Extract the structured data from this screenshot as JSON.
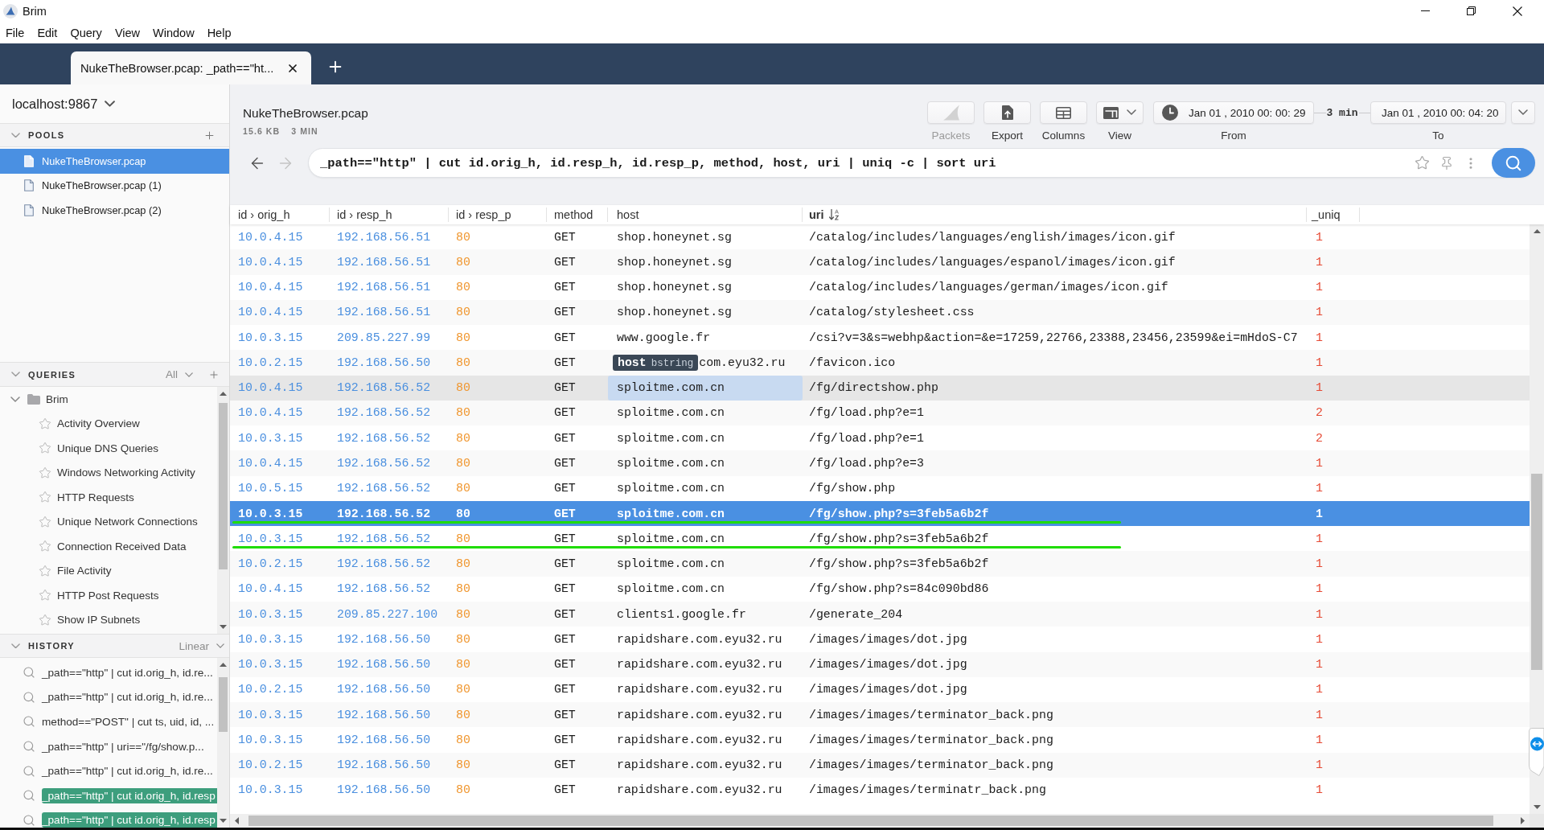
{
  "window": {
    "title": "Brim"
  },
  "menu": [
    "File",
    "Edit",
    "Query",
    "View",
    "Window",
    "Help"
  ],
  "tabs": [
    {
      "label": "NukeTheBrowser.pcap: _path==\"ht...",
      "selected": true
    }
  ],
  "sidebar": {
    "workspace": "localhost:9867",
    "pools": {
      "title": "POOLS",
      "expanded": true,
      "items": [
        {
          "name": "NukeTheBrowser.pcap",
          "selected": true
        },
        {
          "name": "NukeTheBrowser.pcap (1)",
          "selected": false
        },
        {
          "name": "NukeTheBrowser.pcap (2)",
          "selected": false
        }
      ]
    },
    "queries": {
      "title": "QUERIES",
      "filter": "All",
      "expanded": true,
      "folders": [
        {
          "name": "Brim",
          "expanded": true,
          "children": [
            {
              "name": "Activity Overview",
              "starred": false
            },
            {
              "name": "Unique DNS Queries",
              "starred": false
            },
            {
              "name": "Windows Networking Activity",
              "starred": false
            },
            {
              "name": "HTTP Requests",
              "starred": false
            },
            {
              "name": "Unique Network Connections",
              "starred": false
            },
            {
              "name": "Connection Received Data",
              "starred": false
            },
            {
              "name": "File Activity",
              "starred": false
            },
            {
              "name": "HTTP Post Requests",
              "starred": false
            },
            {
              "name": "Show IP Subnets",
              "starred": false
            }
          ]
        }
      ]
    },
    "history": {
      "title": "HISTORY",
      "mode": "Linear",
      "expanded": true,
      "items": [
        {
          "query": "_path==\"http\" | cut id.orig_h, id.re...",
          "highlighted": false
        },
        {
          "query": "_path==\"http\" | cut id.orig_h, id.re...",
          "highlighted": false
        },
        {
          "query": "method==\"POST\" | cut ts, uid, id, ...",
          "highlighted": false
        },
        {
          "query": "_path==\"http\" | uri==\"/fg/show.p...",
          "highlighted": false
        },
        {
          "query": "_path==\"http\" | cut id.orig_h, id.re...",
          "highlighted": false
        },
        {
          "query": "_path==\"http\" | cut id.orig_h, id.resp",
          "highlighted": true
        },
        {
          "query": "_path==\"http\" | cut id.orig_h, id.resp",
          "highlighted": true
        }
      ]
    }
  },
  "pool_header": {
    "name": "NukeTheBrowser.pcap",
    "size": "15.6 KB",
    "duration": "3 MIN"
  },
  "toolbar": {
    "buttons": [
      {
        "kind": "packets",
        "label": "Packets",
        "disabled": true
      },
      {
        "kind": "export",
        "label": "Export",
        "disabled": false
      },
      {
        "kind": "columns",
        "label": "Columns",
        "disabled": false
      },
      {
        "kind": "view",
        "label": "View",
        "disabled": false
      }
    ],
    "time_range": {
      "from": "Jan 01 , 2010 00: 00: 29",
      "from_label": "From",
      "span": "3 min",
      "to": "Jan 01 , 2010 00: 04: 20",
      "to_label": "To"
    }
  },
  "search": {
    "query": "_path==\"http\" | cut id.orig_h, id.resp_h, id.resp_p, method, host, uri | uniq -c | sort uri",
    "back_disabled": false,
    "forward_disabled": true
  },
  "table": {
    "columns": [
      {
        "label": "id › orig_h",
        "kind": "address",
        "sorted": false
      },
      {
        "label": "id › resp_h",
        "kind": "address",
        "sorted": false
      },
      {
        "label": "id › resp_p",
        "kind": "port",
        "sorted": false
      },
      {
        "label": "method",
        "kind": "text",
        "sorted": false
      },
      {
        "label": "host",
        "kind": "host",
        "sorted": false
      },
      {
        "label": "uri",
        "kind": "text",
        "sorted": true
      },
      {
        "label": "_uniq",
        "kind": "count",
        "sorted": false
      }
    ],
    "rows": [
      {
        "cells": [
          "10.0.4.15",
          "192.168.56.51",
          "80",
          "GET",
          "shop.honeynet.sg",
          "/catalog/includes/languages/english/images/icon.gif",
          "1"
        ],
        "selected": false,
        "hovered": false,
        "host_focused": false,
        "underlined": false
      },
      {
        "cells": [
          "10.0.4.15",
          "192.168.56.51",
          "80",
          "GET",
          "shop.honeynet.sg",
          "/catalog/includes/languages/espanol/images/icon.gif",
          "1"
        ],
        "selected": false,
        "hovered": false,
        "host_focused": false,
        "underlined": false
      },
      {
        "cells": [
          "10.0.4.15",
          "192.168.56.51",
          "80",
          "GET",
          "shop.honeynet.sg",
          "/catalog/includes/languages/german/images/icon.gif",
          "1"
        ],
        "selected": false,
        "hovered": false,
        "host_focused": false,
        "underlined": false
      },
      {
        "cells": [
          "10.0.4.15",
          "192.168.56.51",
          "80",
          "GET",
          "shop.honeynet.sg",
          "/catalog/stylesheet.css",
          "1"
        ],
        "selected": false,
        "hovered": false,
        "host_focused": false,
        "underlined": false
      },
      {
        "cells": [
          "10.0.3.15",
          "209.85.227.99",
          "80",
          "GET",
          "www.google.fr",
          "/csi?v=3&s=webhp&action=&e=17259,22766,23388,23456,23599&ei=mHdoS-C7",
          "1"
        ],
        "selected": false,
        "hovered": false,
        "host_focused": false,
        "underlined": false
      },
      {
        "cells": [
          "10.0.2.15",
          "192.168.56.50",
          "80",
          "GET",
          "com.eyu32.ru",
          "/favicon.ico",
          "1"
        ],
        "selected": false,
        "hovered": false,
        "host_focused": false,
        "underlined": false,
        "tooltip": {
          "name": "host",
          "type": "bstring"
        }
      },
      {
        "cells": [
          "10.0.4.15",
          "192.168.56.52",
          "80",
          "GET",
          "sploitme.com.cn",
          "/fg/directshow.php",
          "1"
        ],
        "selected": false,
        "hovered": true,
        "host_focused": true,
        "underlined": false
      },
      {
        "cells": [
          "10.0.4.15",
          "192.168.56.52",
          "80",
          "GET",
          "sploitme.com.cn",
          "/fg/load.php?e=1",
          "2"
        ],
        "selected": false,
        "hovered": false,
        "host_focused": false,
        "underlined": false
      },
      {
        "cells": [
          "10.0.3.15",
          "192.168.56.52",
          "80",
          "GET",
          "sploitme.com.cn",
          "/fg/load.php?e=1",
          "2"
        ],
        "selected": false,
        "hovered": false,
        "host_focused": false,
        "underlined": false
      },
      {
        "cells": [
          "10.0.4.15",
          "192.168.56.52",
          "80",
          "GET",
          "sploitme.com.cn",
          "/fg/load.php?e=3",
          "1"
        ],
        "selected": false,
        "hovered": false,
        "host_focused": false,
        "underlined": false
      },
      {
        "cells": [
          "10.0.5.15",
          "192.168.56.52",
          "80",
          "GET",
          "sploitme.com.cn",
          "/fg/show.php",
          "1"
        ],
        "selected": false,
        "hovered": false,
        "host_focused": false,
        "underlined": false
      },
      {
        "cells": [
          "10.0.3.15",
          "192.168.56.52",
          "80",
          "GET",
          "sploitme.com.cn",
          "/fg/show.php?s=3feb5a6b2f",
          "1"
        ],
        "selected": true,
        "hovered": false,
        "host_focused": false,
        "underlined": true
      },
      {
        "cells": [
          "10.0.3.15",
          "192.168.56.52",
          "80",
          "GET",
          "sploitme.com.cn",
          "/fg/show.php?s=3feb5a6b2f",
          "1"
        ],
        "selected": false,
        "hovered": false,
        "host_focused": false,
        "underlined": true
      },
      {
        "cells": [
          "10.0.2.15",
          "192.168.56.52",
          "80",
          "GET",
          "sploitme.com.cn",
          "/fg/show.php?s=3feb5a6b2f",
          "1"
        ],
        "selected": false,
        "hovered": false,
        "host_focused": false,
        "underlined": false
      },
      {
        "cells": [
          "10.0.4.15",
          "192.168.56.52",
          "80",
          "GET",
          "sploitme.com.cn",
          "/fg/show.php?s=84c090bd86",
          "1"
        ],
        "selected": false,
        "hovered": false,
        "host_focused": false,
        "underlined": false
      },
      {
        "cells": [
          "10.0.3.15",
          "209.85.227.100",
          "80",
          "GET",
          "clients1.google.fr",
          "/generate_204",
          "1"
        ],
        "selected": false,
        "hovered": false,
        "host_focused": false,
        "underlined": false
      },
      {
        "cells": [
          "10.0.3.15",
          "192.168.56.50",
          "80",
          "GET",
          "rapidshare.com.eyu32.ru",
          "/images/images/dot.jpg",
          "1"
        ],
        "selected": false,
        "hovered": false,
        "host_focused": false,
        "underlined": false
      },
      {
        "cells": [
          "10.0.3.15",
          "192.168.56.50",
          "80",
          "GET",
          "rapidshare.com.eyu32.ru",
          "/images/images/dot.jpg",
          "1"
        ],
        "selected": false,
        "hovered": false,
        "host_focused": false,
        "underlined": false
      },
      {
        "cells": [
          "10.0.2.15",
          "192.168.56.50",
          "80",
          "GET",
          "rapidshare.com.eyu32.ru",
          "/images/images/dot.jpg",
          "1"
        ],
        "selected": false,
        "hovered": false,
        "host_focused": false,
        "underlined": false
      },
      {
        "cells": [
          "10.0.3.15",
          "192.168.56.50",
          "80",
          "GET",
          "rapidshare.com.eyu32.ru",
          "/images/images/terminator_back.png",
          "1"
        ],
        "selected": false,
        "hovered": false,
        "host_focused": false,
        "underlined": false
      },
      {
        "cells": [
          "10.0.3.15",
          "192.168.56.50",
          "80",
          "GET",
          "rapidshare.com.eyu32.ru",
          "/images/images/terminator_back.png",
          "1"
        ],
        "selected": false,
        "hovered": false,
        "host_focused": false,
        "underlined": false
      },
      {
        "cells": [
          "10.0.2.15",
          "192.168.56.50",
          "80",
          "GET",
          "rapidshare.com.eyu32.ru",
          "/images/images/terminator_back.png",
          "1"
        ],
        "selected": false,
        "hovered": false,
        "host_focused": false,
        "underlined": false
      },
      {
        "cells": [
          "10.0.3.15",
          "192.168.56.50",
          "80",
          "GET",
          "rapidshare.com.eyu32.ru",
          "/images/images/terminatr_back.png",
          "1"
        ],
        "selected": false,
        "hovered": false,
        "host_focused": false,
        "underlined": false
      }
    ]
  }
}
